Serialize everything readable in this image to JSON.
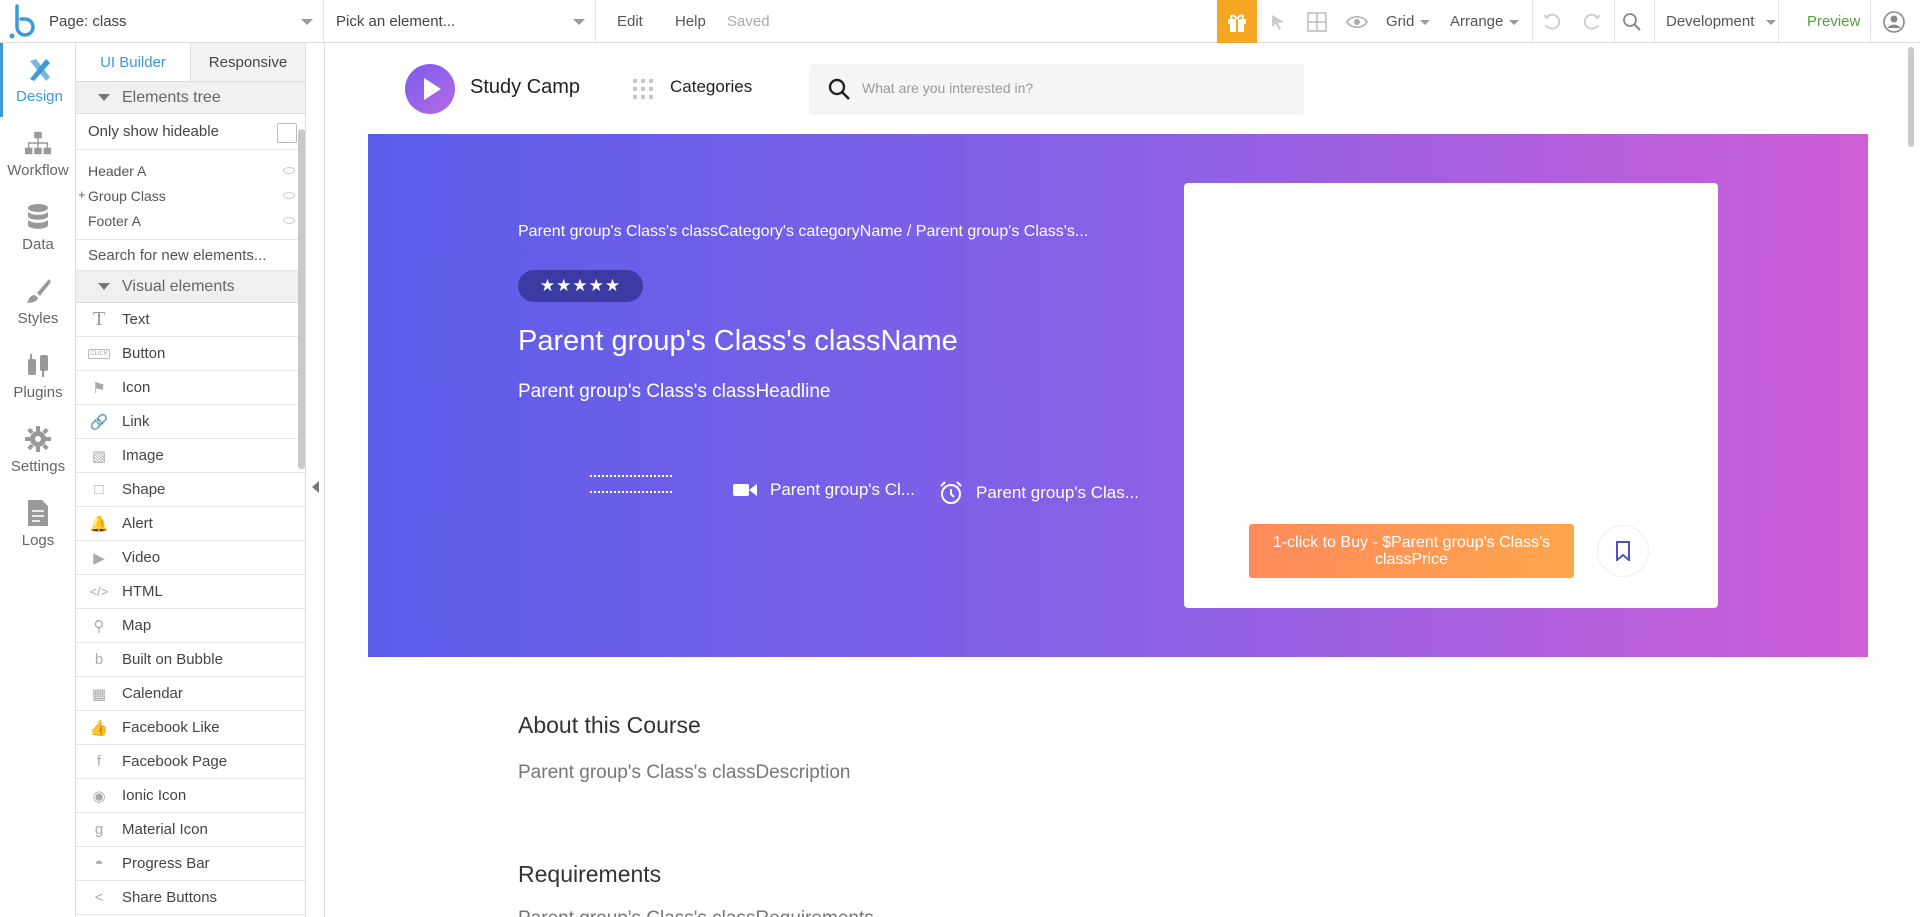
{
  "topbar": {
    "page_label": "Page: class",
    "element_placeholder": "Pick an element...",
    "edit": "Edit",
    "help": "Help",
    "saved": "Saved",
    "grid": "Grid",
    "arrange": "Arrange",
    "environment": "Development",
    "preview": "Preview",
    "accent": "#f5a623"
  },
  "rail": {
    "items": [
      {
        "label": "Design",
        "icon": "design-icon"
      },
      {
        "label": "Workflow",
        "icon": "workflow-icon"
      },
      {
        "label": "Data",
        "icon": "database-icon"
      },
      {
        "label": "Styles",
        "icon": "brush-icon"
      },
      {
        "label": "Plugins",
        "icon": "plug-icon"
      },
      {
        "label": "Settings",
        "icon": "gear-icon"
      },
      {
        "label": "Logs",
        "icon": "document-icon"
      }
    ]
  },
  "panel": {
    "tabs": [
      "UI Builder",
      "Responsive"
    ],
    "elements_tree": "Elements tree",
    "only_show_hideable": "Only show hideable",
    "tree": [
      "Header A",
      "Group Class",
      "Footer A"
    ],
    "tree_expand": "+",
    "search_new": "Search for new elements...",
    "visual_elements": "Visual elements",
    "visual": [
      {
        "label": "Text",
        "icon": "T"
      },
      {
        "label": "Button",
        "icon": "CLICK"
      },
      {
        "label": "Icon",
        "icon": "⚑"
      },
      {
        "label": "Link",
        "icon": "🔗"
      },
      {
        "label": "Image",
        "icon": "▧"
      },
      {
        "label": "Shape",
        "icon": "□"
      },
      {
        "label": "Alert",
        "icon": "🔔"
      },
      {
        "label": "Video",
        "icon": "▶"
      },
      {
        "label": "HTML",
        "icon": "</>"
      },
      {
        "label": "Map",
        "icon": "⚲"
      },
      {
        "label": "Built on Bubble",
        "icon": "b"
      },
      {
        "label": "Calendar",
        "icon": "▦"
      },
      {
        "label": "Facebook Like",
        "icon": "👍"
      },
      {
        "label": "Facebook Page",
        "icon": "f"
      },
      {
        "label": "Ionic Icon",
        "icon": "◉"
      },
      {
        "label": "Material Icon",
        "icon": "g"
      },
      {
        "label": "Progress Bar",
        "icon": "◓"
      },
      {
        "label": "Share Buttons",
        "icon": "<"
      }
    ]
  },
  "site": {
    "name": "Study Camp",
    "categories": "Categories",
    "search_placeholder": "What are you interested in?"
  },
  "hero": {
    "breadcrumb": "Parent group's Class's classCategory's categoryName  /  Parent group's Class's...",
    "rating": "★★★★★",
    "title": "Parent group's Class's className",
    "headline": "Parent group's Class's classHeadline",
    "meta_video": "Parent group's Cl...",
    "meta_time": "Parent group's Clas...",
    "buy_button": "1-click to Buy - $Parent group's Class's classPrice"
  },
  "content": {
    "about_title": "About this Course",
    "about_text": "Parent group's Class's classDescription",
    "requirements_title": "Requirements",
    "requirements_text": "Parent group's Class's classRequirements"
  }
}
